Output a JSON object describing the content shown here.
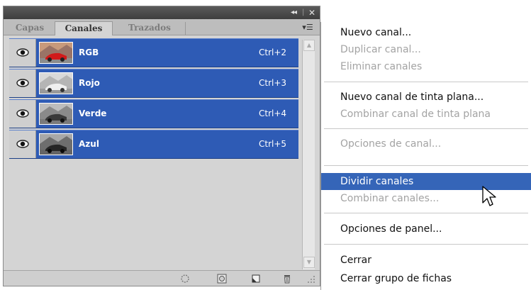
{
  "panel": {
    "tabs": [
      "Capas",
      "Canales",
      "Trazados"
    ],
    "active_tab": "Canales",
    "titlebar": {
      "collapse_icon": "double-chevron-icon",
      "close_icon": "close-icon"
    },
    "channels": [
      {
        "name": "RGB",
        "shortcut": "Ctrl+2",
        "visible": true,
        "thumb": "color"
      },
      {
        "name": "Rojo",
        "shortcut": "Ctrl+3",
        "visible": true,
        "thumb": "gray-light"
      },
      {
        "name": "Verde",
        "shortcut": "Ctrl+4",
        "visible": true,
        "thumb": "gray-mid"
      },
      {
        "name": "Azul",
        "shortcut": "Ctrl+5",
        "visible": true,
        "thumb": "gray-dark"
      }
    ],
    "bottom_icons": [
      "load-selection-icon",
      "save-selection-icon",
      "new-channel-icon",
      "trash-icon"
    ]
  },
  "menu": {
    "items": [
      {
        "label": "Nuevo canal...",
        "enabled": true
      },
      {
        "label": "Duplicar canal...",
        "enabled": false
      },
      {
        "label": "Eliminar canales",
        "enabled": false
      },
      {
        "separator": true
      },
      {
        "label": "Nuevo canal de tinta plana...",
        "enabled": true
      },
      {
        "label": "Combinar canal de tinta plana",
        "enabled": false
      },
      {
        "separator": true
      },
      {
        "label": "Opciones de canal...",
        "enabled": false
      },
      {
        "separator": true
      },
      {
        "label": "Dividir canales",
        "enabled": true,
        "selected": true
      },
      {
        "label": "Combinar canales...",
        "enabled": false
      },
      {
        "separator": true
      },
      {
        "label": "Opciones de panel...",
        "enabled": true
      },
      {
        "separator": true
      },
      {
        "label": "Cerrar",
        "enabled": true
      },
      {
        "label": "Cerrar grupo de fichas",
        "enabled": true
      }
    ]
  },
  "colors": {
    "selection": "#2e5bb5",
    "menu_highlight": "#3565b8",
    "panel_bg": "#d4d4d4"
  }
}
